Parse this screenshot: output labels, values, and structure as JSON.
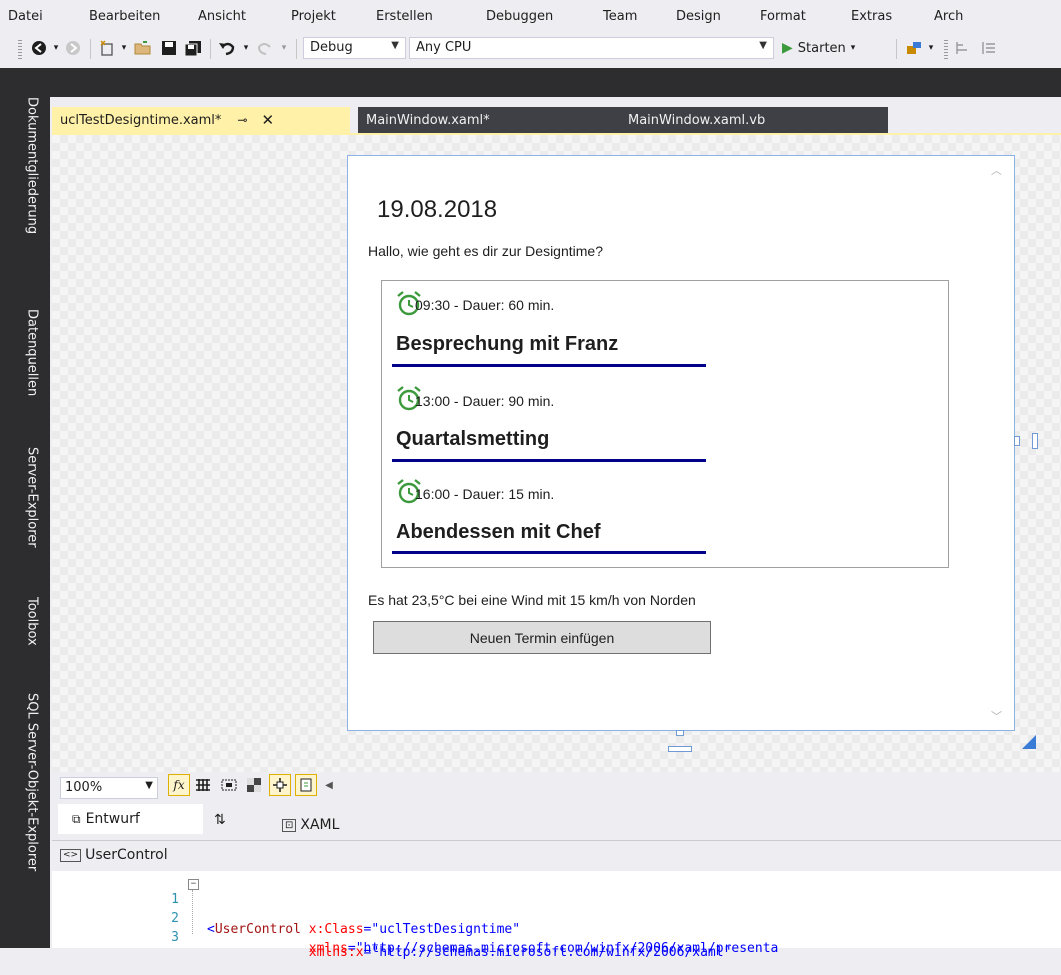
{
  "menu": [
    "Datei",
    "Bearbeiten",
    "Ansicht",
    "Projekt",
    "Erstellen",
    "Debuggen",
    "Team",
    "Design",
    "Format",
    "Extras",
    "Arch"
  ],
  "toolbar": {
    "config": "Debug",
    "platform": "Any CPU",
    "start_label": "Starten"
  },
  "side_tabs": [
    "Dokumentgliederung",
    "Datenquellen",
    "Server-Explorer",
    "Toolbox",
    "SQL Server-Objekt-Explorer"
  ],
  "doc_tabs": [
    {
      "label": "uclTestDesigntime.xaml*",
      "active": true
    },
    {
      "label": "MainWindow.xaml*",
      "active": false
    },
    {
      "label": "MainWindow.xaml.vb",
      "active": false
    }
  ],
  "designer": {
    "date": "19.08.2018",
    "greeting": "Hallo, wie geht es dir zur Designtime?",
    "appointments": [
      {
        "time": "09:30 - Dauer: 60 min.",
        "title": "Besprechung mit Franz"
      },
      {
        "time": "13:00 - Dauer: 90 min.",
        "title": "Quartalsmetting"
      },
      {
        "time": "16:00 - Dauer: 15 min.",
        "title": "Abendessen mit Chef"
      }
    ],
    "weather": "Es hat 23,5°C bei eine Wind mit 15 km/h von Norden",
    "add_button": "Neuen Termin einfügen"
  },
  "zoom": "100%",
  "split_tabs": {
    "design": "Entwurf",
    "swap": "⇅",
    "xaml": "XAML"
  },
  "breadcrumb": "UserControl",
  "code_lines": [
    {
      "num": "1",
      "parts": [
        {
          "cls": "pun",
          "t": "<"
        },
        {
          "cls": "tagc",
          "t": "UserControl"
        },
        {
          "cls": "",
          "t": " "
        },
        {
          "cls": "attr",
          "t": "x:Class"
        },
        {
          "cls": "pun",
          "t": "="
        },
        {
          "cls": "val",
          "t": "\"uclTestDesigntime\""
        }
      ]
    },
    {
      "num": "2",
      "parts": [
        {
          "cls": "",
          "t": "             "
        },
        {
          "cls": "attr",
          "t": "xmlns"
        },
        {
          "cls": "pun",
          "t": "="
        },
        {
          "cls": "val",
          "t": "\"http://schemas.microsoft.com/winfx/2006/xaml/presenta"
        }
      ]
    },
    {
      "num": "3",
      "parts": [
        {
          "cls": "",
          "t": "             "
        },
        {
          "cls": "attr",
          "t": "xmlns:x"
        },
        {
          "cls": "pun",
          "t": "="
        },
        {
          "cls": "val",
          "t": "\"http://schemas.microsoft.com/winfx/2006/xaml\""
        }
      ]
    }
  ],
  "colors": {
    "active_tab": "#fff1a8",
    "dark_chrome": "#2d2d30",
    "underline": "#00008b",
    "clock_green": "#3c9a3c",
    "selection_border": "#8cb3e8"
  }
}
